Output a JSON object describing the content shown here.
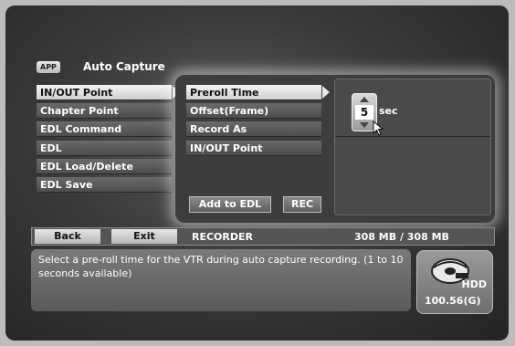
{
  "header": {
    "badge": "APP",
    "title": "Auto Capture"
  },
  "menu_main": {
    "items": [
      {
        "label": "IN/OUT Point",
        "selected": true
      },
      {
        "label": "Chapter Point",
        "selected": false
      },
      {
        "label": "EDL Command",
        "selected": false
      },
      {
        "label": "EDL",
        "selected": false
      },
      {
        "label": "EDL Load/Delete",
        "selected": false
      },
      {
        "label": "EDL Save",
        "selected": false
      }
    ]
  },
  "menu_sub": {
    "items": [
      {
        "label": "Preroll Time",
        "selected": true
      },
      {
        "label": "Offset(Frame)",
        "selected": false
      },
      {
        "label": "Record As",
        "selected": false
      },
      {
        "label": "IN/OUT Point",
        "selected": false
      }
    ]
  },
  "setting": {
    "value": "5",
    "unit": "sec"
  },
  "actions": {
    "add_to_edl": "Add to EDL",
    "rec": "REC"
  },
  "status_bar": {
    "back": "Back",
    "exit": "Exit",
    "source": "RECORDER",
    "storage": "308 MB / 308 MB"
  },
  "message": "Select a pre-roll time for the VTR during auto capture recording. (1 to 10 seconds available)",
  "hdd": {
    "label": "HDD",
    "capacity": "100.56(G)"
  }
}
